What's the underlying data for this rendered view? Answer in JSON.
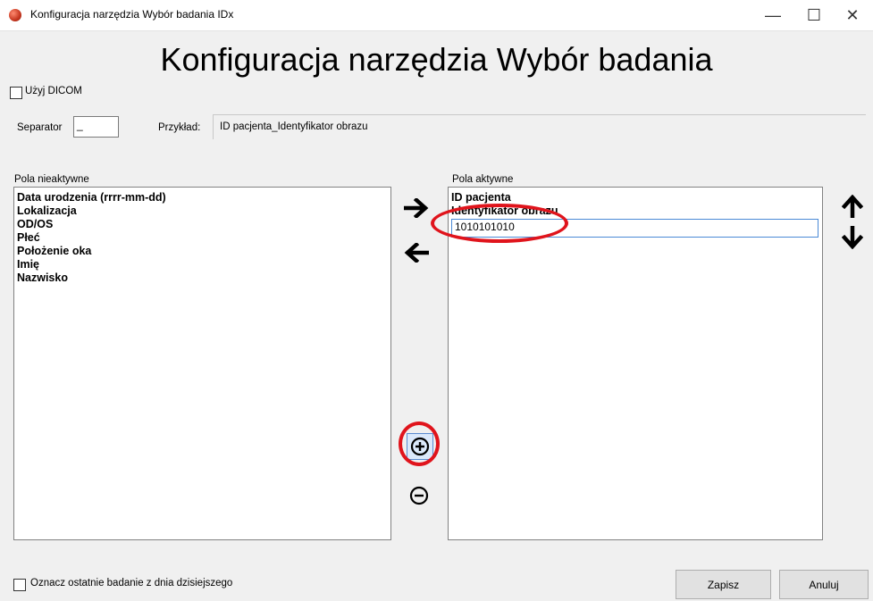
{
  "window": {
    "title": "Konfiguracja narzędzia Wybór badania IDx",
    "minimize_glyph": "—",
    "maximize_glyph": "☐",
    "close_glyph": "✕"
  },
  "heading": "Konfiguracja narzędzia Wybór badania",
  "use_dicom": {
    "label": "Użyj DICOM",
    "checked": false
  },
  "separator": {
    "label": "Separator",
    "value": "_"
  },
  "example": {
    "label": "Przykład:",
    "value": "ID pacjenta_Identyfikator obrazu"
  },
  "inactive_fields": {
    "label": "Pola nieaktywne",
    "items": [
      "Data urodzenia (rrrr-mm-dd)",
      "Lokalizacja",
      "OD/OS",
      "Płeć",
      "Położenie oka",
      "Imię",
      "Nazwisko"
    ]
  },
  "active_fields": {
    "label": "Pola aktywne",
    "items": [
      "ID pacjenta",
      "Identyfikator obrazu"
    ],
    "edit_value": "1010101010"
  },
  "icons": {
    "move_right": "arrow-right-icon",
    "move_left": "arrow-left-icon",
    "move_up": "arrow-up-icon",
    "move_down": "arrow-down-icon",
    "add": "plus-circle-icon",
    "remove": "minus-circle-icon"
  },
  "highlight_color": "#e0141c",
  "mark_latest": {
    "label": "Oznacz ostatnie badanie z dnia dzisiejszego",
    "checked": false
  },
  "buttons": {
    "save": "Zapisz",
    "cancel": "Anuluj"
  }
}
